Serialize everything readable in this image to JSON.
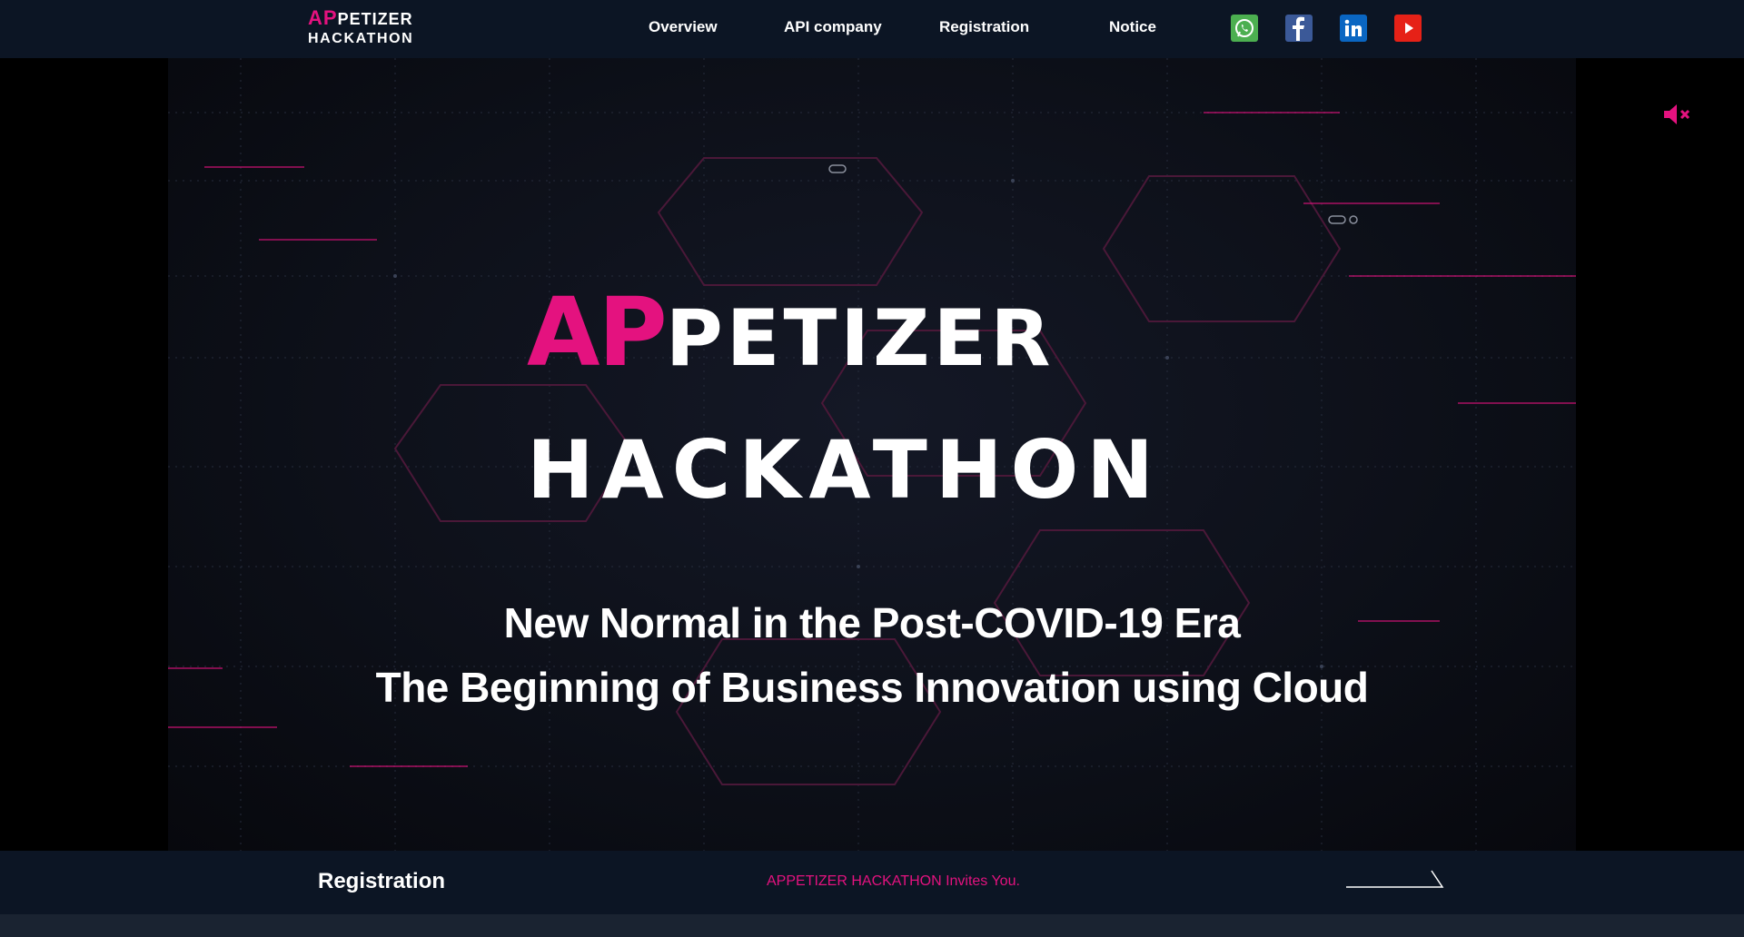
{
  "header": {
    "logo": {
      "line1_pink": "AP",
      "line1_white": "PETIZER",
      "line2": "HACKATHON"
    },
    "nav": [
      {
        "label": "Overview"
      },
      {
        "label": "API company"
      },
      {
        "label": "Registration"
      },
      {
        "label": "Notice"
      }
    ],
    "social": [
      {
        "name": "whatsapp-icon",
        "color": "#4caf50"
      },
      {
        "name": "facebook-icon",
        "color": "#3b5998"
      },
      {
        "name": "linkedin-icon",
        "color": "#0a66c2"
      },
      {
        "name": "youtube-icon",
        "color": "#e62117"
      }
    ]
  },
  "hero": {
    "title_pink": "AP",
    "title_white": "PETIZER",
    "title_line2": "HACKATHON",
    "subtitle_1": "New Normal in the Post-COVID-19 Era",
    "subtitle_2": "The Beginning of Business Innovation using Cloud",
    "mute_icon": "speaker-muted-icon"
  },
  "bottom_bar": {
    "title": "Registration",
    "invite_text": "APPETIZER HACKATHON Invites You.",
    "arrow_icon": "long-arrow-right-icon"
  },
  "colors": {
    "accent": "#e4127f",
    "header_bg": "#0c1524",
    "video_bg": "#0d1019"
  }
}
